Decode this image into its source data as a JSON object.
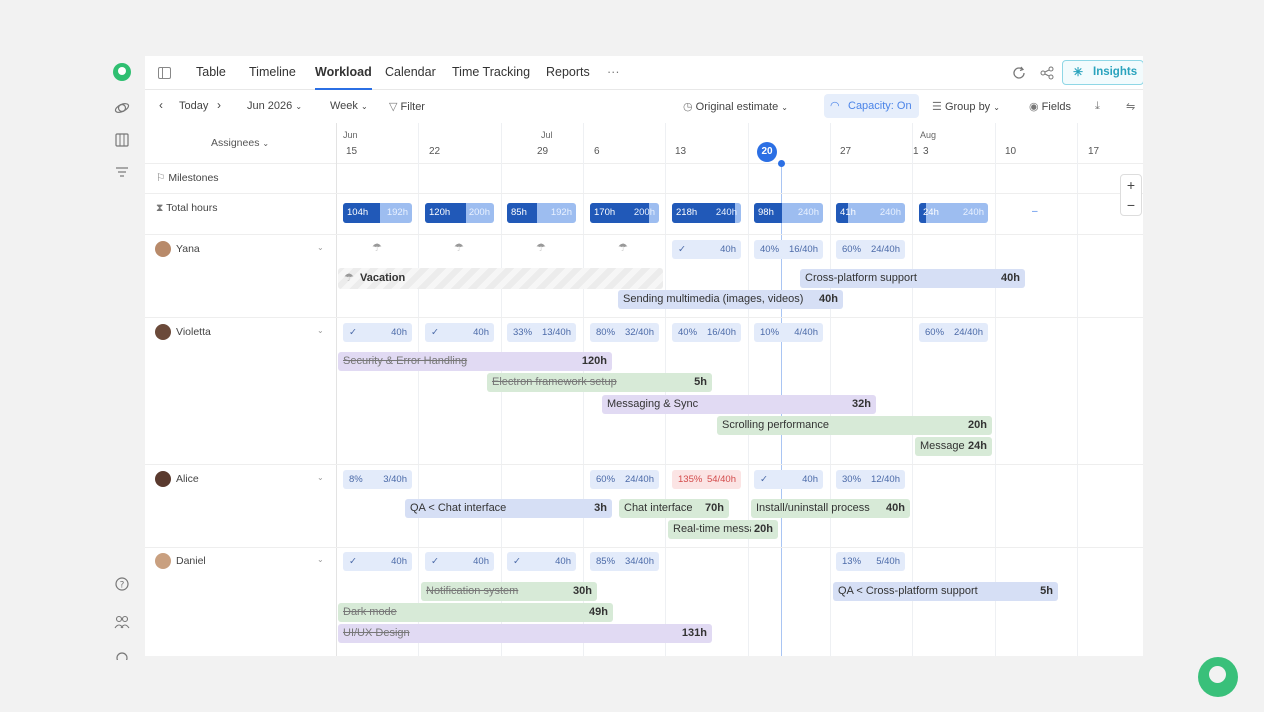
{
  "tabs": [
    "Table",
    "Timeline",
    "Workload",
    "Calendar",
    "Time Tracking",
    "Reports",
    "···"
  ],
  "insights": "Insights",
  "toolbar": {
    "today": "Today",
    "month": "Jun 2026",
    "range": "Week",
    "filter": "Filter",
    "estimate": "Original estimate",
    "capacity": "Capacity: On",
    "group": "Group by",
    "fields": "Fields"
  },
  "header": {
    "assignees": "Assignees",
    "months": [
      "Jun",
      "Jul",
      "Aug"
    ],
    "days": [
      "15",
      "22",
      "29",
      "6",
      "13",
      "20",
      "27",
      "1",
      "3",
      "10",
      "17"
    ]
  },
  "rows": {
    "milestones": "Milestones",
    "total": "Total hours"
  },
  "totals": [
    [
      "104h",
      "192h"
    ],
    [
      "120h",
      "200h"
    ],
    [
      "85h",
      "192h"
    ],
    [
      "170h",
      "200h"
    ],
    [
      "218h",
      "240h"
    ],
    [
      "98h",
      "240h"
    ],
    [
      "41h",
      "240h"
    ],
    [
      "24h",
      "240h"
    ],
    [
      "–"
    ]
  ],
  "people": [
    {
      "name": "Yana",
      "caps": [
        [
          "",
          "40h"
        ],
        [
          "40%",
          "16/40h"
        ],
        [
          "60%",
          "24/40h"
        ]
      ],
      "vacation": "Vacation",
      "tasks": [
        {
          "name": "Cross-platform support",
          "hours": "40h"
        },
        {
          "name": "Sending multimedia (images, videos)",
          "hours": "40h"
        }
      ]
    },
    {
      "name": "Violetta",
      "caps": [
        [
          "",
          "40h"
        ],
        [
          "",
          "40h"
        ],
        [
          "33%",
          "13/40h"
        ],
        [
          "80%",
          "32/40h"
        ],
        [
          "40%",
          "16/40h"
        ],
        [
          "10%",
          "4/40h"
        ],
        [
          "60%",
          "24/40h"
        ]
      ],
      "tasks": [
        {
          "name": "Security & Error Handling",
          "hours": "120h"
        },
        {
          "name": "Electron framework setup",
          "hours": "5h"
        },
        {
          "name": "Messaging & Sync",
          "hours": "32h"
        },
        {
          "name": "Scrolling performance",
          "hours": "20h"
        },
        {
          "name": "Message",
          "hours": "24h"
        }
      ]
    },
    {
      "name": "Alice",
      "caps": [
        [
          "8%",
          "3/40h"
        ],
        [
          "60%",
          "24/40h"
        ],
        [
          "135%",
          "54/40h"
        ],
        [
          "",
          "40h"
        ],
        [
          "30%",
          "12/40h"
        ]
      ],
      "tasks": [
        {
          "name": "QA < Chat interface",
          "hours": "3h"
        },
        {
          "name": "Chat interface",
          "hours": "70h"
        },
        {
          "name": "Install/uninstall process",
          "hours": "40h"
        },
        {
          "name": "Real-time messa",
          "hours": "20h"
        }
      ]
    },
    {
      "name": "Daniel",
      "caps": [
        [
          "",
          "40h"
        ],
        [
          "",
          "40h"
        ],
        [
          "",
          "40h"
        ],
        [
          "85%",
          "34/40h"
        ],
        [
          "13%",
          "5/40h"
        ]
      ],
      "tasks": [
        {
          "name": "Notification system",
          "hours": "30h"
        },
        {
          "name": "QA < Cross-platform support",
          "hours": "5h"
        },
        {
          "name": "Dark mode",
          "hours": "49h"
        },
        {
          "name": "UI/UX Design",
          "hours": "131h"
        }
      ]
    }
  ],
  "colors": {
    "accent": "#2b6fe4",
    "brand": "#2fbf71"
  }
}
